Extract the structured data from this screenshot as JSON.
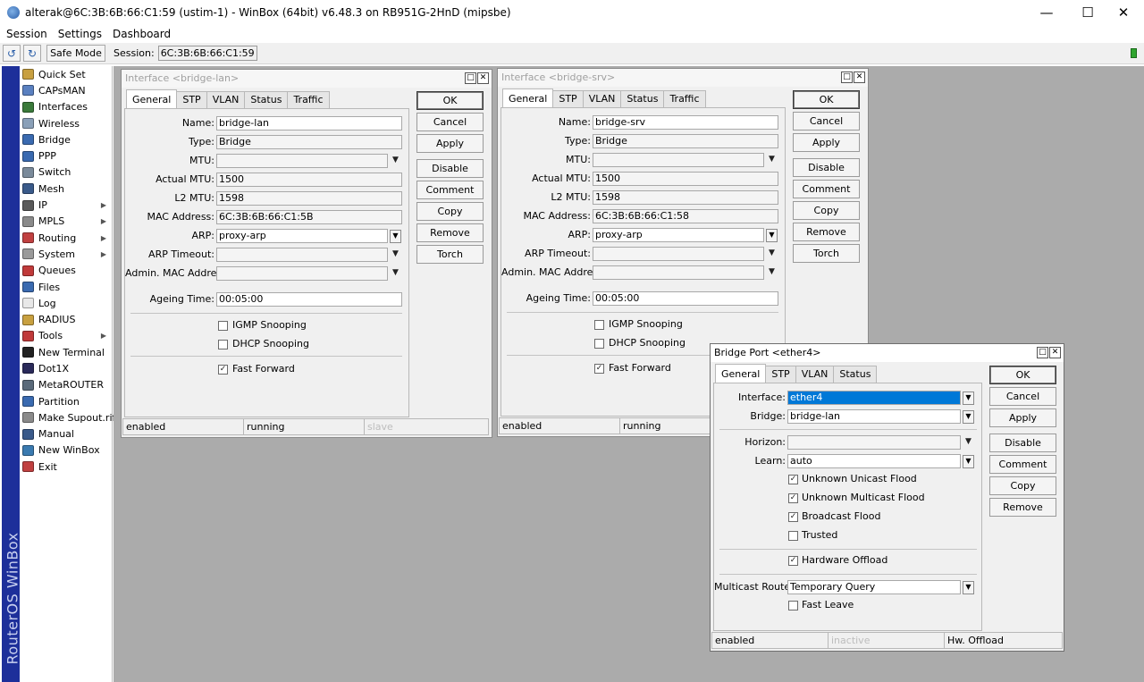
{
  "app": {
    "title": "alterak@6C:3B:6B:66:C1:59 (ustim-1) - WinBox (64bit) v6.48.3 on RB951G-2HnD (mipsbe)",
    "menu": [
      "Session",
      "Settings",
      "Dashboard"
    ],
    "toolbar": {
      "safe_mode": "Safe Mode",
      "session_label": "Session:",
      "session_value": "6C:3B:6B:66:C1:59"
    },
    "vertical_label": "RouterOS WinBox"
  },
  "sidebar": {
    "items": [
      {
        "label": "Quick Set",
        "icon": "quick-set-icon",
        "color": "#c8a040",
        "sub": false
      },
      {
        "label": "CAPsMAN",
        "icon": "capsman-icon",
        "color": "#5a80c0",
        "sub": false
      },
      {
        "label": "Interfaces",
        "icon": "interfaces-icon",
        "color": "#3a7a3a",
        "sub": false
      },
      {
        "label": "Wireless",
        "icon": "wireless-icon",
        "color": "#8aa0b8",
        "sub": false
      },
      {
        "label": "Bridge",
        "icon": "bridge-icon",
        "color": "#3a6ab0",
        "sub": false
      },
      {
        "label": "PPP",
        "icon": "ppp-icon",
        "color": "#3a6ab0",
        "sub": false
      },
      {
        "label": "Switch",
        "icon": "switch-icon",
        "color": "#7a8a9a",
        "sub": false
      },
      {
        "label": "Mesh",
        "icon": "mesh-icon",
        "color": "#3a5a8a",
        "sub": false
      },
      {
        "label": "IP",
        "icon": "ip-icon",
        "color": "#5a5a5a",
        "sub": true
      },
      {
        "label": "MPLS",
        "icon": "mpls-icon",
        "color": "#8a8a8a",
        "sub": true
      },
      {
        "label": "Routing",
        "icon": "routing-icon",
        "color": "#c04040",
        "sub": true
      },
      {
        "label": "System",
        "icon": "system-icon",
        "color": "#9a9a9a",
        "sub": true
      },
      {
        "label": "Queues",
        "icon": "queues-icon",
        "color": "#c03a3a",
        "sub": false
      },
      {
        "label": "Files",
        "icon": "files-icon",
        "color": "#3a6ab0",
        "sub": false
      },
      {
        "label": "Log",
        "icon": "log-icon",
        "color": "#e8e8e8",
        "sub": false
      },
      {
        "label": "RADIUS",
        "icon": "radius-icon",
        "color": "#c8a040",
        "sub": false
      },
      {
        "label": "Tools",
        "icon": "tools-icon",
        "color": "#c03a3a",
        "sub": true
      },
      {
        "label": "New Terminal",
        "icon": "terminal-icon",
        "color": "#222222",
        "sub": false
      },
      {
        "label": "Dot1X",
        "icon": "dot1x-icon",
        "color": "#2a2a5a",
        "sub": false
      },
      {
        "label": "MetaROUTER",
        "icon": "metarouter-icon",
        "color": "#5a6a7a",
        "sub": false
      },
      {
        "label": "Partition",
        "icon": "partition-icon",
        "color": "#3a6ab0",
        "sub": false
      },
      {
        "label": "Make Supout.rif",
        "icon": "supout-icon",
        "color": "#8a8a8a",
        "sub": false
      },
      {
        "label": "Manual",
        "icon": "manual-icon",
        "color": "#3a5a8a",
        "sub": false
      },
      {
        "label": "New WinBox",
        "icon": "winbox-icon",
        "color": "#3a7ab0",
        "sub": false
      },
      {
        "label": "Exit",
        "icon": "exit-icon",
        "color": "#c04040",
        "sub": false
      }
    ]
  },
  "win_lan": {
    "title": "Interface <bridge-lan>",
    "tabs": [
      "General",
      "STP",
      "VLAN",
      "Status",
      "Traffic"
    ],
    "labels": {
      "name": "Name:",
      "type": "Type:",
      "mtu": "MTU:",
      "actual_mtu": "Actual MTU:",
      "l2_mtu": "L2 MTU:",
      "mac": "MAC Address:",
      "arp": "ARP:",
      "arp_timeout": "ARP Timeout:",
      "admin_mac": "Admin. MAC Address:",
      "ageing": "Ageing Time:"
    },
    "values": {
      "name": "bridge-lan",
      "type": "Bridge",
      "mtu": "",
      "actual_mtu": "1500",
      "l2_mtu": "1598",
      "mac": "6C:3B:6B:66:C1:5B",
      "arp": "proxy-arp",
      "arp_timeout": "",
      "admin_mac": "",
      "ageing": "00:05:00"
    },
    "checks": {
      "igmp": "IGMP Snooping",
      "dhcp": "DHCP Snooping",
      "fast": "Fast Forward"
    },
    "buttons": [
      "OK",
      "Cancel",
      "Apply",
      "Disable",
      "Comment",
      "Copy",
      "Remove",
      "Torch"
    ],
    "status": [
      "enabled",
      "running",
      "slave"
    ]
  },
  "win_srv": {
    "title": "Interface <bridge-srv>",
    "tabs": [
      "General",
      "STP",
      "VLAN",
      "Status",
      "Traffic"
    ],
    "labels": {
      "name": "Name:",
      "type": "Type:",
      "mtu": "MTU:",
      "actual_mtu": "Actual MTU:",
      "l2_mtu": "L2 MTU:",
      "mac": "MAC Address:",
      "arp": "ARP:",
      "arp_timeout": "ARP Timeout:",
      "admin_mac": "Admin. MAC Address:",
      "ageing": "Ageing Time:"
    },
    "values": {
      "name": "bridge-srv",
      "type": "Bridge",
      "mtu": "",
      "actual_mtu": "1500",
      "l2_mtu": "1598",
      "mac": "6C:3B:6B:66:C1:58",
      "arp": "proxy-arp",
      "arp_timeout": "",
      "admin_mac": "",
      "ageing": "00:05:00"
    },
    "checks": {
      "igmp": "IGMP Snooping",
      "dhcp": "DHCP Snooping",
      "fast": "Fast Forward"
    },
    "buttons": [
      "OK",
      "Cancel",
      "Apply",
      "Disable",
      "Comment",
      "Copy",
      "Remove",
      "Torch"
    ],
    "status": [
      "enabled",
      "running"
    ]
  },
  "win_port": {
    "title": "Bridge Port <ether4>",
    "tabs": [
      "General",
      "STP",
      "VLAN",
      "Status"
    ],
    "labels": {
      "interface": "Interface:",
      "bridge": "Bridge:",
      "horizon": "Horizon:",
      "learn": "Learn:",
      "mcast_router": "Multicast Router:"
    },
    "values": {
      "interface": "ether4",
      "bridge": "bridge-lan",
      "horizon": "",
      "learn": "auto",
      "mcast_router": "Temporary Query"
    },
    "checks": {
      "unicast": "Unknown Unicast Flood",
      "multicast": "Unknown Multicast Flood",
      "broadcast": "Broadcast Flood",
      "trusted": "Trusted",
      "hw": "Hardware Offload",
      "fast_leave": "Fast Leave"
    },
    "buttons": [
      "OK",
      "Cancel",
      "Apply",
      "Disable",
      "Comment",
      "Copy",
      "Remove"
    ],
    "status": [
      "enabled",
      "inactive",
      "Hw. Offload"
    ]
  }
}
